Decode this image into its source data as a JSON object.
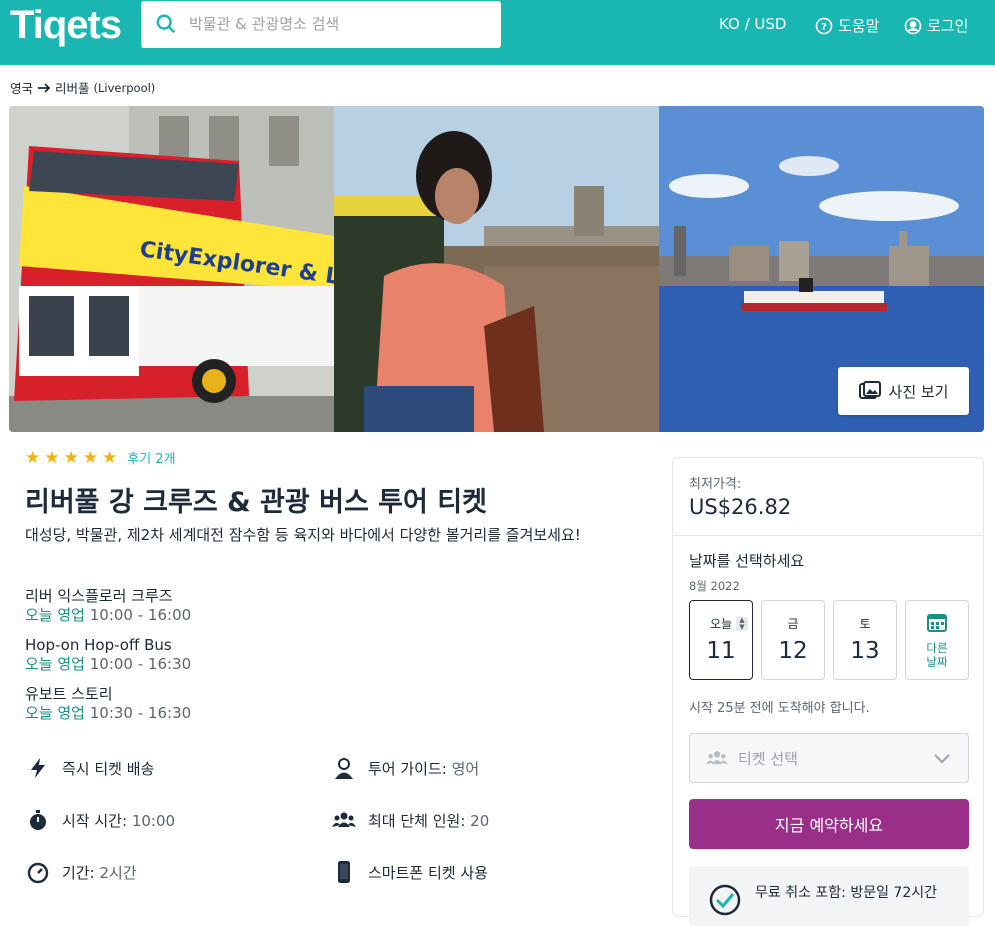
{
  "header": {
    "logo": "Tiqets",
    "search_placeholder": "박물관 & 관광명소 검색",
    "locale": "KO / USD",
    "help": "도움말",
    "login": "로그인"
  },
  "breadcrumb": {
    "country": "영국",
    "city": "리버풀",
    "city_en": "(Liverpool)"
  },
  "gallery": {
    "view_photos": "사진 보기",
    "bus_sign": "CityExplorer & Liverpool"
  },
  "rating": {
    "stars": 5,
    "reviews": "후기 2개"
  },
  "product": {
    "title": "리버풀 강 크루즈 & 관광 버스 투어 티켓",
    "subtitle": "대성당, 박물관, 제2차 세계대전 잠수함 등 육지와 바다에서 다양한 볼거리를 즐겨보세요!"
  },
  "hours": [
    {
      "name": "리버 익스플로러 크루즈",
      "open": "오늘 영업",
      "time": "10:00 - 16:00"
    },
    {
      "name": "Hop-on Hop-off Bus",
      "open": "오늘 영업",
      "time": "10:00 - 16:30"
    },
    {
      "name": "유보트 스토리",
      "open": "오늘 영업",
      "time": "10:30 - 16:30"
    }
  ],
  "features": {
    "instant": "즉시 티켓 배송",
    "guide_label": "투어 가이드:",
    "guide_value": "영어",
    "start_label": "시작 시간:",
    "start_value": "10:00",
    "group_label": "최대 단체 인원:",
    "group_value": "20",
    "duration_label": "기간:",
    "duration_value": "2시간",
    "mobile": "스마트폰 티켓 사용"
  },
  "booking": {
    "from_label": "최저가격:",
    "price": "US$26.82",
    "choose_date": "날짜를 선택하세요",
    "month": "8월 2022",
    "days": [
      {
        "label": "오늘",
        "num": "11"
      },
      {
        "label": "금",
        "num": "12"
      },
      {
        "label": "토",
        "num": "13"
      }
    ],
    "other_date_1": "다른",
    "other_date_2": "날짜",
    "arrive_note": "시작 25분 전에 도착해야 합니다.",
    "ticket_select": "티켓 선택",
    "book_now": "지금 예약하세요",
    "free_cancel": "무료 취소 포함: 방문일 72시간"
  },
  "colors": {
    "brand": "#1ab7b2",
    "book_button": "#9a2f8a",
    "star": "#f5b10e"
  }
}
